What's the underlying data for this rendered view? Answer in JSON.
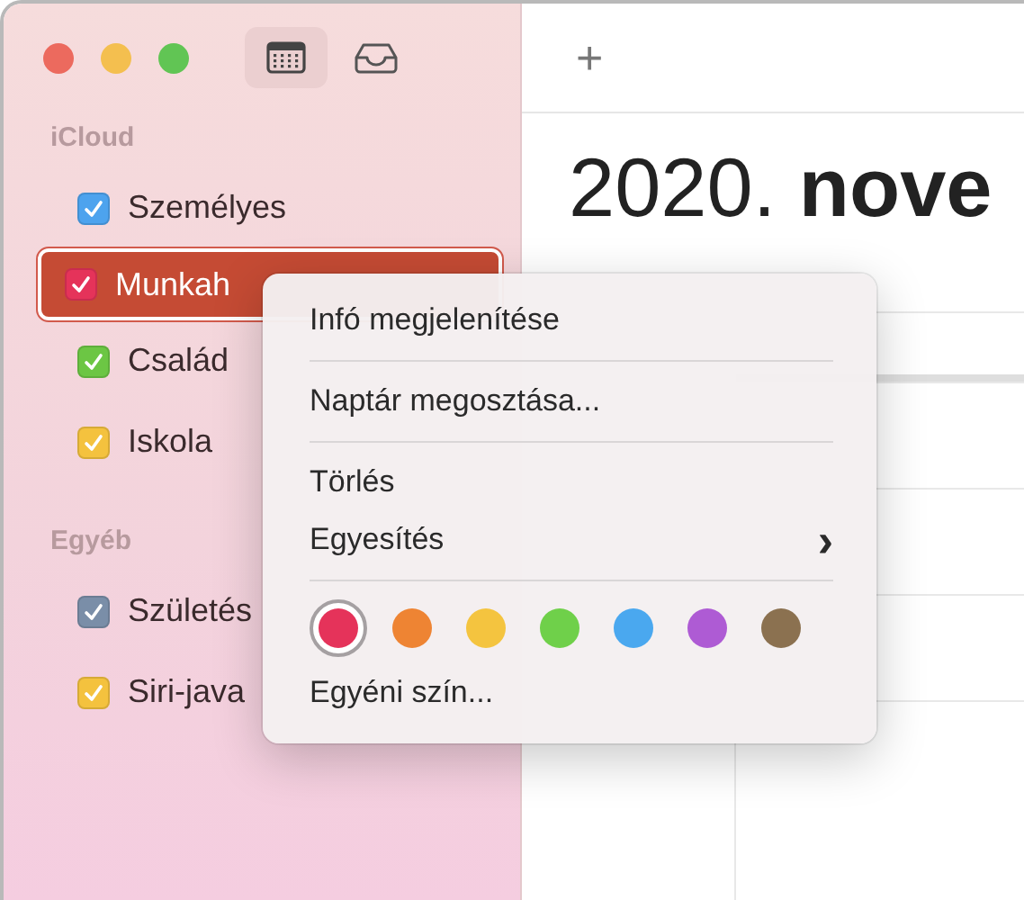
{
  "toolbar": {
    "buttons": [
      {
        "kind": "calendar",
        "selected": true
      },
      {
        "kind": "inbox",
        "selected": false
      }
    ]
  },
  "sidebar": {
    "sections": [
      {
        "title": "iCloud",
        "items": [
          {
            "label": "Személyes",
            "checked": true,
            "color": "#4da3ee",
            "selected": false
          },
          {
            "label": "Munkah",
            "checked": true,
            "color": "#e5335a",
            "selected": true
          },
          {
            "label": "Család",
            "checked": true,
            "color": "#6cc644",
            "selected": false
          },
          {
            "label": "Iskola",
            "checked": true,
            "color": "#f4c23e",
            "selected": false
          }
        ]
      },
      {
        "title": "Egyéb",
        "items": [
          {
            "label": "Születés",
            "checked": true,
            "color": "#7a8ea8",
            "selected": false
          },
          {
            "label": "Siri-java",
            "checked": true,
            "color": "#f4c23e",
            "selected": false
          }
        ]
      }
    ]
  },
  "main": {
    "add_button": "+",
    "title": "2020. **nove**"
  },
  "context_menu": {
    "entries": [
      {
        "kind": "item",
        "label": "Infó megjelenítése"
      },
      {
        "kind": "separator"
      },
      {
        "kind": "item",
        "label": "Naptár megosztása..."
      },
      {
        "kind": "separator"
      },
      {
        "kind": "item",
        "label": "Törlés"
      },
      {
        "kind": "submenu",
        "label": "Egyesítés",
        "arrow": "›"
      },
      {
        "kind": "separator"
      },
      {
        "kind": "colors",
        "colors": [
          {
            "color": "#e5335a",
            "selected": true
          },
          {
            "color": "#ee8433",
            "selected": false
          },
          {
            "color": "#f4c43f",
            "selected": false
          },
          {
            "color": "#6fd04a",
            "selected": false
          },
          {
            "color": "#4aa8ef",
            "selected": false
          },
          {
            "color": "#ae5bd4",
            "selected": false
          },
          {
            "color": "#8b7150",
            "selected": false
          }
        ]
      },
      {
        "kind": "item",
        "label": "Egyéni szín..."
      }
    ]
  }
}
